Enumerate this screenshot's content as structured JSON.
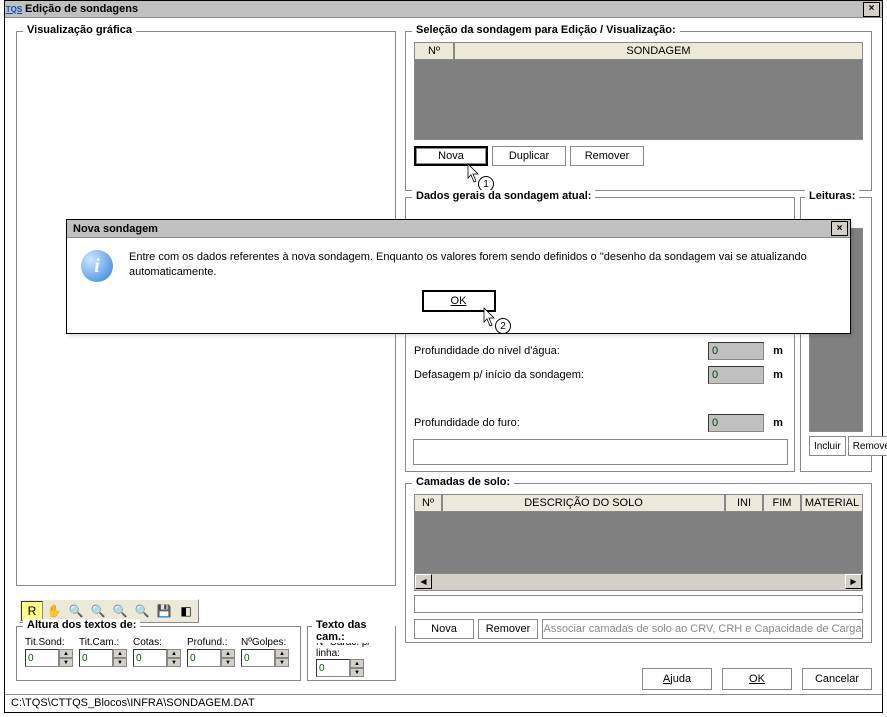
{
  "window": {
    "title": "Edição de sondagens"
  },
  "groups": {
    "viz": "Visualização gráfica",
    "sel": "Seleção da sondagem para Edição / Visualização:",
    "dados": "Dados gerais da sondagem atual:",
    "leituras": "Leituras:",
    "camadas": "Camadas de solo:",
    "altura": "Altura dos textos de:",
    "texto": "Texto das cam.:"
  },
  "sel": {
    "headers": {
      "num": "Nº",
      "sondagem": "SONDAGEM"
    },
    "buttons": {
      "nova": "Nova",
      "duplicar": "Duplicar",
      "remover": "Remover"
    }
  },
  "steps": {
    "s1": "1",
    "s2": "2"
  },
  "dados": {
    "prof_agua_label": "Profundidade do nível d'água:",
    "defasagem_label": "Defasagem p/ início da sondagem:",
    "prof_furo_label": "Profundidade do furo:",
    "prof_agua_val": "0",
    "defasagem_val": "0",
    "prof_furo_val": "0",
    "unit": "m"
  },
  "leituras": {
    "incluir": "Incluir",
    "remover": "Remover"
  },
  "camadas": {
    "headers": {
      "num": "Nº",
      "desc": "DESCRIÇÃO DO SOLO",
      "ini": "INI",
      "fim": "FIM",
      "material": "MATERIAL"
    },
    "nova": "Nova",
    "remover": "Remover",
    "assoc": "Associar camadas de solo ao CRV, CRH e Capacidade de Carga"
  },
  "altura": {
    "titsond": "Tit.Sond:",
    "titcam": "Tit.Cam.:",
    "cotas": "Cotas:",
    "profund": "Profund.:",
    "ngolpes": "NºGolpes:",
    "val": "0"
  },
  "texto": {
    "label": "Nº Carac. p/ linha:",
    "val": "0"
  },
  "bottom": {
    "ajuda": "Ajuda",
    "ok": "OK",
    "cancelar": "Cancelar"
  },
  "status": "C:\\TQS\\CTTQS_Blocos\\INFRA\\SONDAGEM.DAT",
  "modal": {
    "title": "Nova sondagem",
    "text": "Entre com os dados referentes à nova sondagem. Enquanto os valores forem sendo definidos o \"desenho da sondagem vai se atualizando automaticamente.",
    "ok": "OK"
  }
}
